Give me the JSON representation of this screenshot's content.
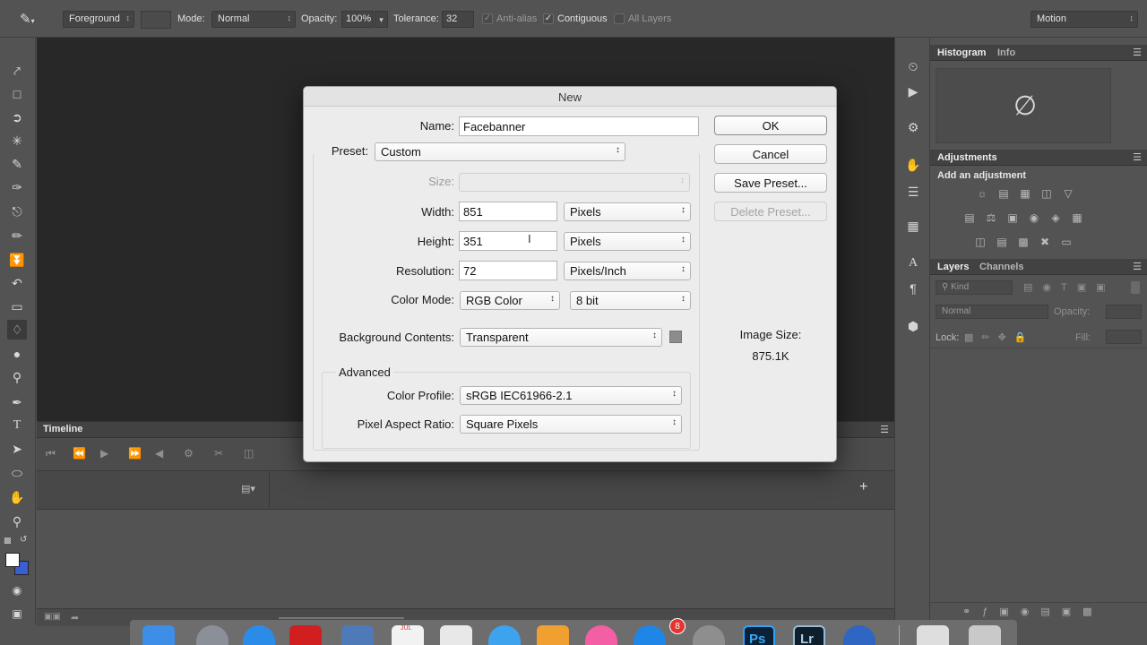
{
  "options_bar": {
    "fill_source": "Foreground",
    "mode_label": "Mode:",
    "mode_value": "Normal",
    "opacity_label": "Opacity:",
    "opacity_value": "100%",
    "tolerance_label": "Tolerance:",
    "tolerance_value": "32",
    "antialias_label": "Anti-alias",
    "contiguous_label": "Contiguous",
    "all_layers_label": "All Layers",
    "workspace_value": "Motion"
  },
  "timeline": {
    "title": "Timeline"
  },
  "panels": {
    "histogram_tab": "Histogram",
    "info_tab": "Info",
    "adjustments_tab": "Adjustments",
    "add_adjustment": "Add an adjustment",
    "layers_tab": "Layers",
    "channels_tab": "Channels",
    "kind_filter": "Kind",
    "blend_mode": "Normal",
    "opacity_label": "Opacity:",
    "lock_label": "Lock:",
    "fill_label": "Fill:"
  },
  "dialog": {
    "title": "New",
    "name_label": "Name:",
    "name_value": "Facebanner",
    "preset_label": "Preset:",
    "preset_value": "Custom",
    "size_label": "Size:",
    "size_value": "",
    "width_label": "Width:",
    "width_value": "851",
    "width_unit": "Pixels",
    "height_label": "Height:",
    "height_value": "351",
    "height_unit": "Pixels",
    "resolution_label": "Resolution:",
    "resolution_value": "72",
    "resolution_unit": "Pixels/Inch",
    "color_mode_label": "Color Mode:",
    "color_mode_value": "RGB Color",
    "bit_depth_value": "8 bit",
    "background_label": "Background Contents:",
    "background_value": "Transparent",
    "advanced_label": "Advanced",
    "color_profile_label": "Color Profile:",
    "color_profile_value": "sRGB IEC61966-2.1",
    "pixel_aspect_label": "Pixel Aspect Ratio:",
    "pixel_aspect_value": "Square Pixels",
    "ok_label": "OK",
    "cancel_label": "Cancel",
    "save_preset_label": "Save Preset...",
    "delete_preset_label": "Delete Preset...",
    "image_size_label": "Image Size:",
    "image_size_value": "875.1K"
  },
  "dock": {
    "notification_badge": "8",
    "calendar_month": "JUL"
  },
  "colors": {
    "foreground": "#ffffff",
    "background": "#3b5fd3",
    "workspace": "#282828",
    "dialog": "#ececec"
  }
}
